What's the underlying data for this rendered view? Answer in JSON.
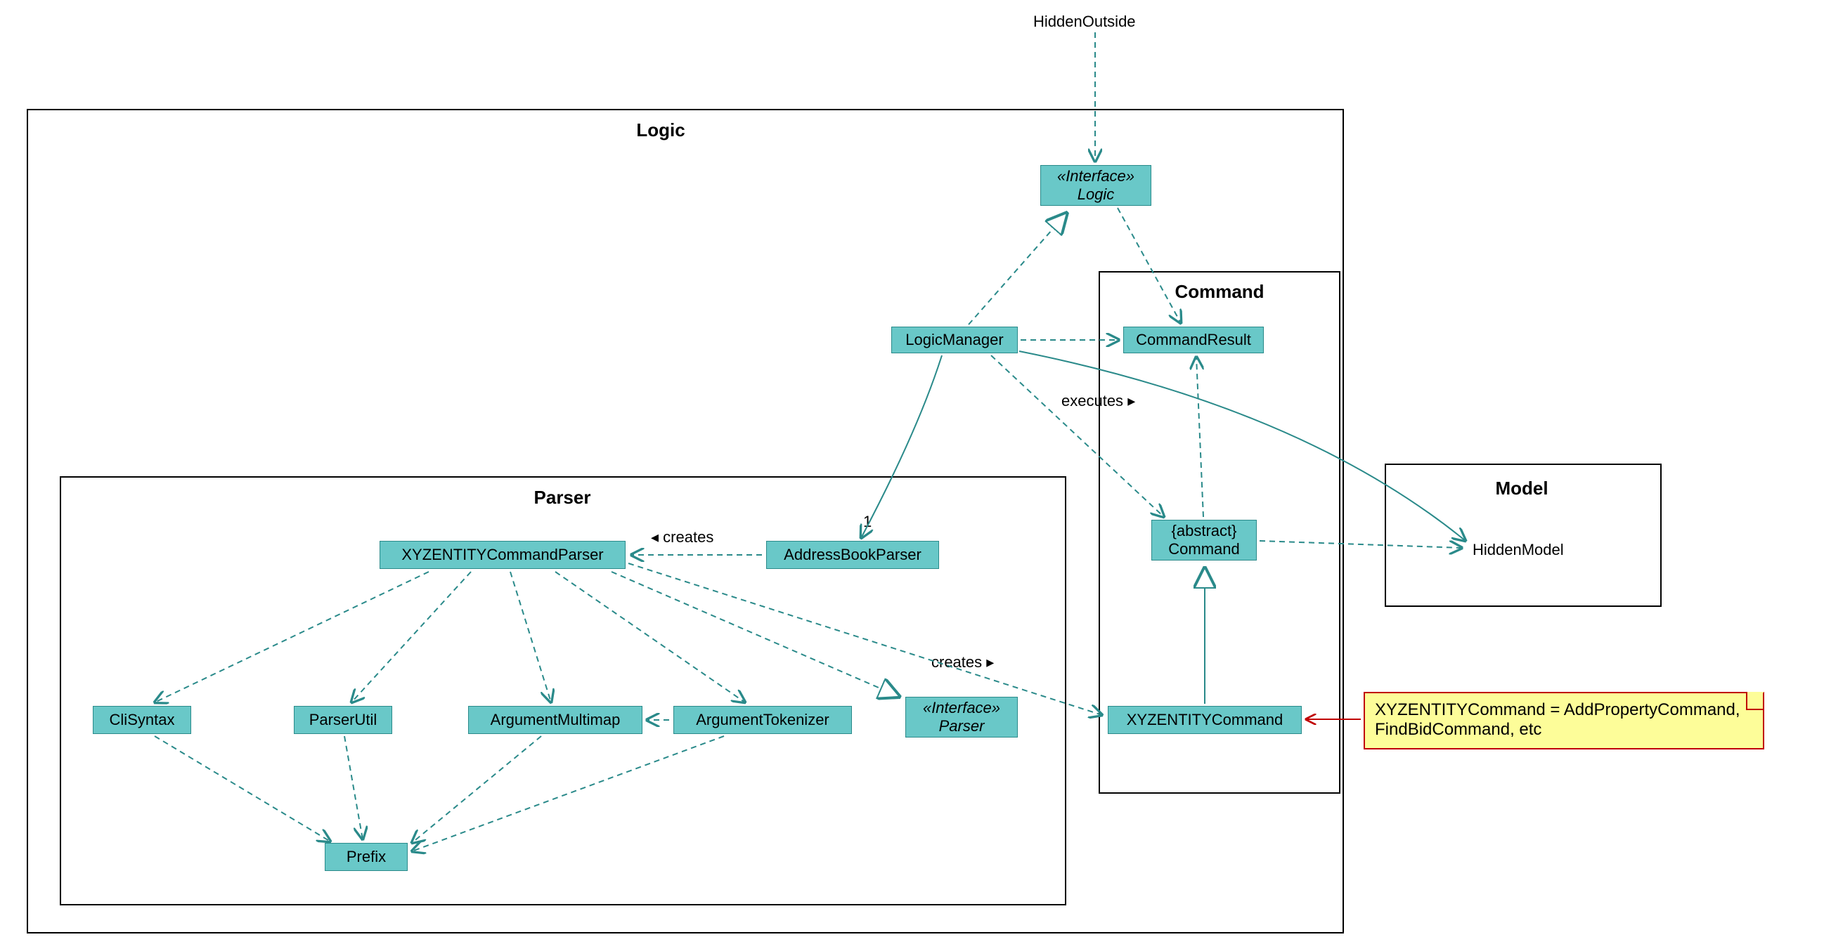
{
  "diagram": {
    "external": {
      "hiddenOutside": "HiddenOutside"
    },
    "packages": {
      "logic": {
        "title": "Logic"
      },
      "parser": {
        "title": "Parser"
      },
      "command": {
        "title": "Command"
      },
      "model": {
        "title": "Model"
      }
    },
    "nodes": {
      "logicInterface": {
        "stereo": "«Interface»",
        "name": "Logic"
      },
      "logicManager": "LogicManager",
      "addressBookParser": "AddressBookParser",
      "xyzEntityCommandParser": "XYZENTITYCommandParser",
      "cliSyntax": "CliSyntax",
      "parserUtil": "ParserUtil",
      "argumentMultimap": "ArgumentMultimap",
      "argumentTokenizer": "ArgumentTokenizer",
      "parserInterface": {
        "stereo": "«Interface»",
        "name": "Parser"
      },
      "prefix": "Prefix",
      "commandResult": "CommandResult",
      "abstractCommand": {
        "stereo": "{abstract}",
        "name": "Command"
      },
      "xyzEntityCommand": "XYZENTITYCommand",
      "hiddenModel": "HiddenModel"
    },
    "labels": {
      "creates1": "creates",
      "creates2": "creates",
      "executes": "executes",
      "one": "1"
    },
    "note": "XYZENTITYCommand = AddPropertyCommand, FindBidCommand, etc",
    "colors": {
      "nodeFill": "#69c8c8",
      "nodeStroke": "#2a8a8a",
      "edge": "#2a8a8a",
      "noteFill": "#fdfd99",
      "noteStroke": "#c00000"
    }
  }
}
